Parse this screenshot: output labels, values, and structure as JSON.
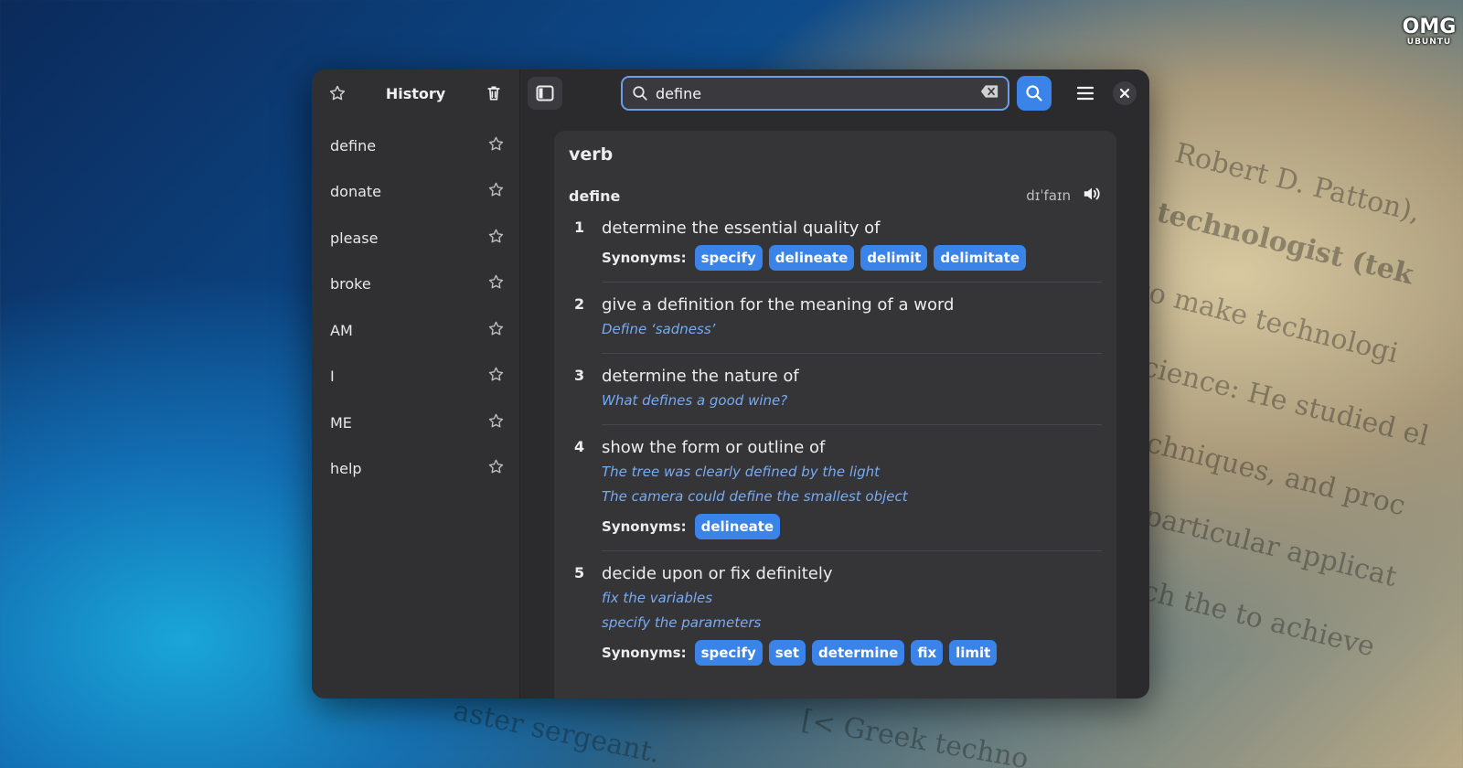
{
  "brand": {
    "line1": "OMG",
    "line2": "UBUNTU"
  },
  "sidebar": {
    "title": "History",
    "items": [
      {
        "label": "define"
      },
      {
        "label": "donate"
      },
      {
        "label": "please"
      },
      {
        "label": "broke"
      },
      {
        "label": "AM"
      },
      {
        "label": "I"
      },
      {
        "label": "ME"
      },
      {
        "label": "help"
      }
    ]
  },
  "search": {
    "value": "define"
  },
  "entry": {
    "part_of_speech": "verb",
    "word": "define",
    "pronunciation": "dɪˈfaɪn",
    "synonyms_label": "Synonyms:",
    "senses": [
      {
        "num": "1",
        "definition": "determine the essential quality of",
        "examples": [],
        "synonyms": [
          "specify",
          "delineate",
          "delimit",
          "delimitate"
        ]
      },
      {
        "num": "2",
        "definition": "give a definition for the meaning of a word",
        "examples": [
          "Define ‘sadness’"
        ],
        "synonyms": []
      },
      {
        "num": "3",
        "definition": "determine the nature of",
        "examples": [
          "What defines a good wine?"
        ],
        "synonyms": []
      },
      {
        "num": "4",
        "definition": "show the form or outline of",
        "examples": [
          "The tree was clearly defined by the light",
          "The camera could define the smallest object"
        ],
        "synonyms": [
          "delineate"
        ]
      },
      {
        "num": "5",
        "definition": "decide upon or fix definitely",
        "examples": [
          "fix the variables",
          "specify the parameters"
        ],
        "synonyms": [
          "specify",
          "set",
          "determine",
          "fix",
          "limit"
        ]
      }
    ]
  },
  "colors": {
    "accent": "#3a83e8",
    "example_text": "#78aaf2",
    "window_bg": "#2b2b2e"
  }
}
